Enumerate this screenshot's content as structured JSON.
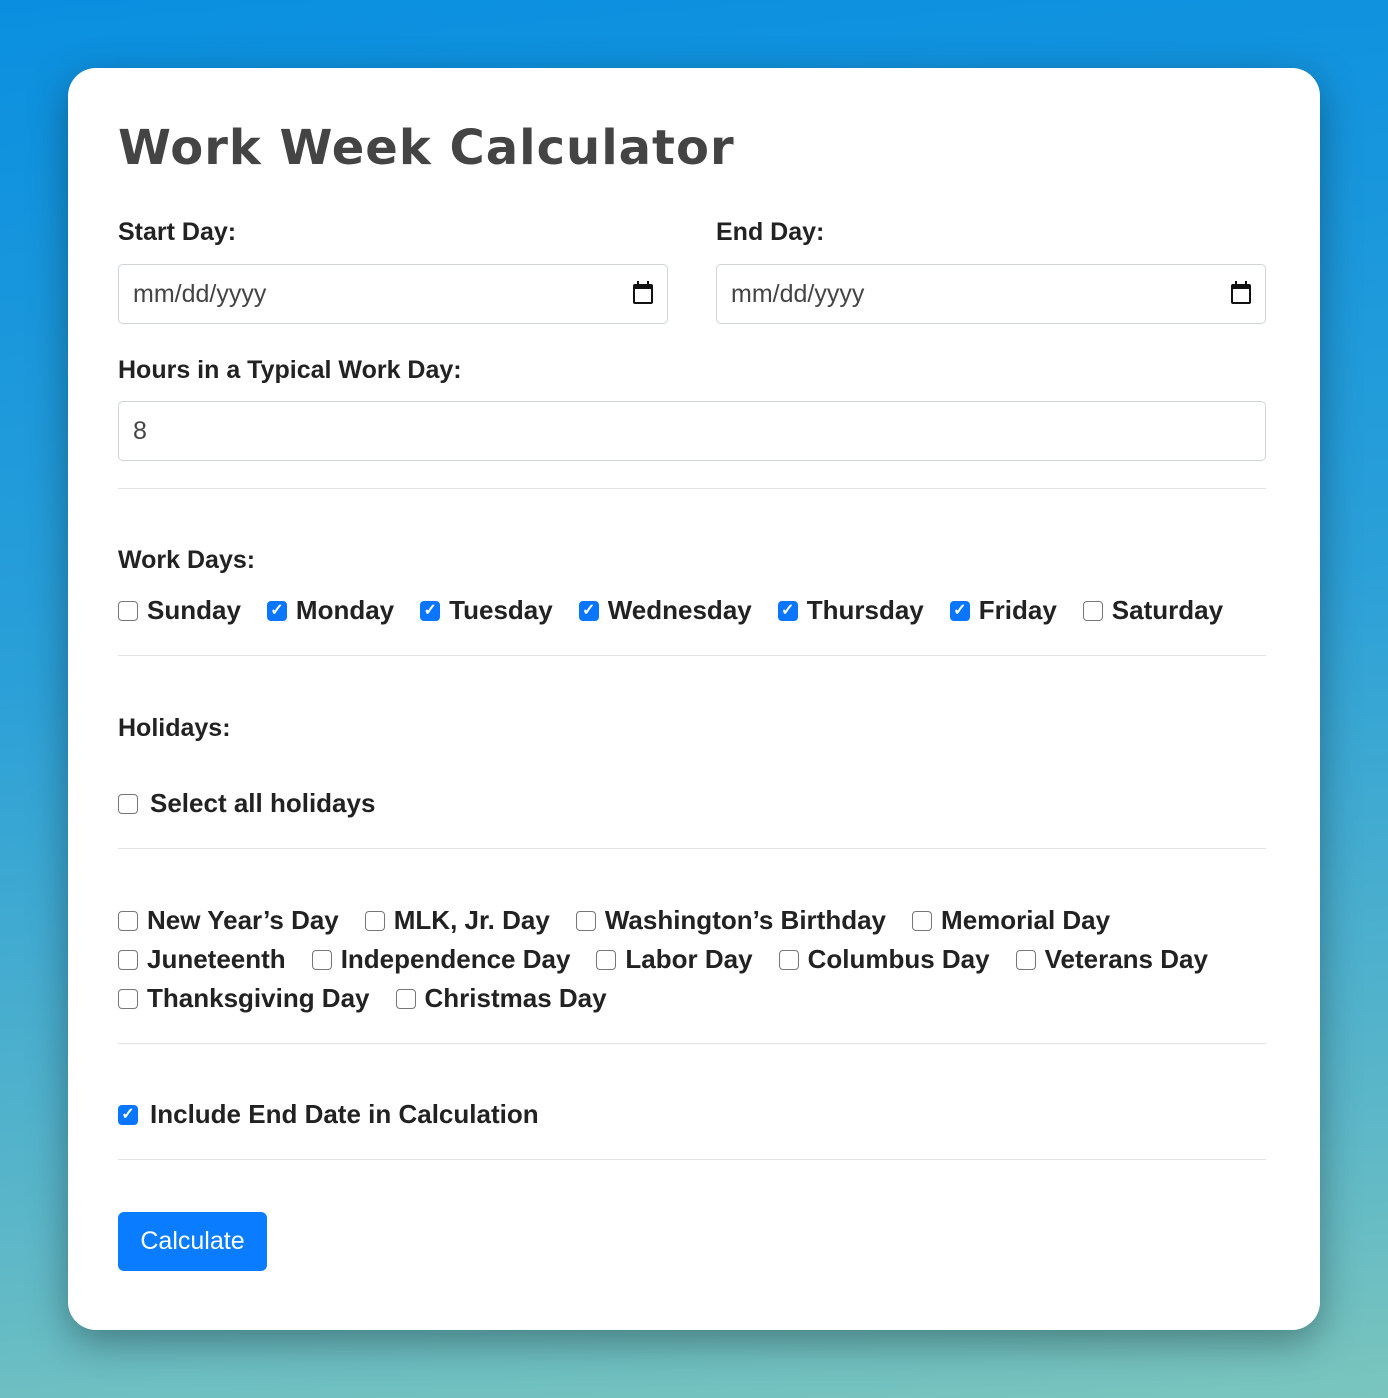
{
  "title": "Work Week Calculator",
  "start": {
    "label": "Start Day:",
    "placeholder": "mm/dd/yyyy",
    "icon": "calendar-icon"
  },
  "end": {
    "label": "End Day:",
    "placeholder": "mm/dd/yyyy",
    "icon": "calendar-icon"
  },
  "hours": {
    "label": "Hours in a Typical Work Day:",
    "value": "8"
  },
  "work_days": {
    "label": "Work Days:",
    "items": [
      {
        "label": "Sunday",
        "checked": false
      },
      {
        "label": "Monday",
        "checked": true
      },
      {
        "label": "Tuesday",
        "checked": true
      },
      {
        "label": "Wednesday",
        "checked": true
      },
      {
        "label": "Thursday",
        "checked": true
      },
      {
        "label": "Friday",
        "checked": true
      },
      {
        "label": "Saturday",
        "checked": false
      }
    ]
  },
  "holidays": {
    "label": "Holidays:",
    "select_all": {
      "label": "Select all holidays",
      "checked": false
    },
    "rows": [
      [
        {
          "label": "New Year’s Day",
          "checked": false
        },
        {
          "label": "MLK, Jr. Day",
          "checked": false
        },
        {
          "label": "Washington’s Birthday",
          "checked": false
        },
        {
          "label": "Memorial Day",
          "checked": false
        }
      ],
      [
        {
          "label": "Juneteenth",
          "checked": false
        },
        {
          "label": "Independence Day",
          "checked": false
        },
        {
          "label": "Labor Day",
          "checked": false
        },
        {
          "label": "Columbus Day",
          "checked": false
        },
        {
          "label": "Veterans Day",
          "checked": false
        }
      ],
      [
        {
          "label": "Thanksgiving Day",
          "checked": false
        },
        {
          "label": "Christmas Day",
          "checked": false
        }
      ]
    ]
  },
  "include_end": {
    "label": "Include End Date in Calculation",
    "checked": true
  },
  "calculate_label": "Calculate",
  "colors": {
    "accent": "#0a7cff",
    "title": "#444444"
  }
}
